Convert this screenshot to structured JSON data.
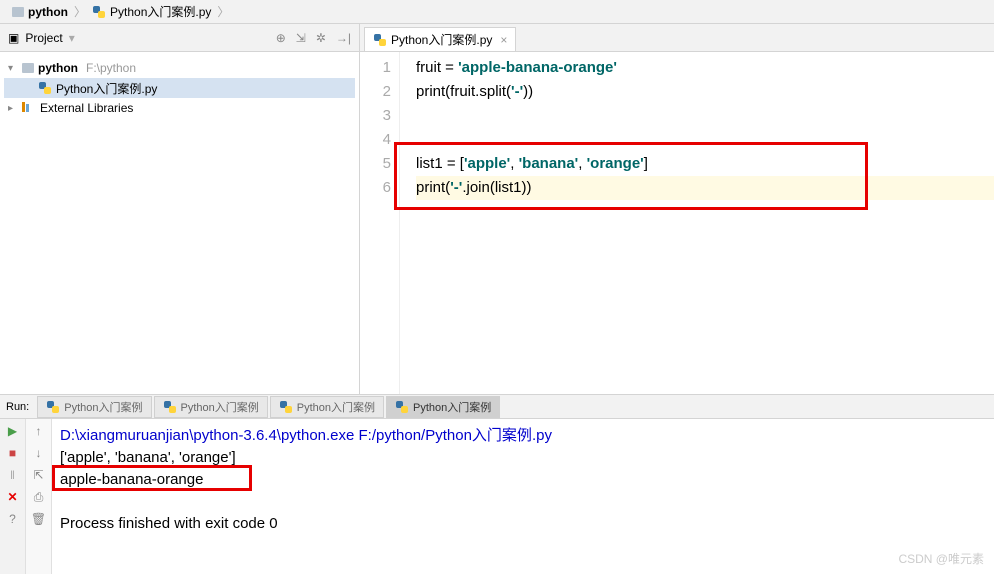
{
  "breadcrumb": {
    "root": "python",
    "file": "Python入门案例.py"
  },
  "project": {
    "header": "Project",
    "root": "python",
    "root_path": "F:\\python",
    "file": "Python入门案例.py",
    "external": "External Libraries"
  },
  "tab": {
    "name": "Python入门案例.py"
  },
  "code": {
    "l1": "fruit = 'apple-banana-orange'",
    "l2_a": "print(fruit.split(",
    "l2_b": "'-'",
    "l2_c": "))",
    "l3": "",
    "l4": "",
    "l5_a": "list1 = [",
    "l5_b": "'apple'",
    "l5_c": ", ",
    "l5_d": "'banana'",
    "l5_e": ", ",
    "l5_f": "'orange'",
    "l5_g": "]",
    "l6_a": "print(",
    "l6_b": "'-'",
    "l6_c": ".join(list1))"
  },
  "gutter": [
    "1",
    "2",
    "3",
    "4",
    "5",
    "6"
  ],
  "run": {
    "label": "Run:",
    "tabs": [
      "Python入门案例",
      "Python入门案例",
      "Python入门案例",
      "Python入门案例"
    ],
    "line1_a": "D:\\xiangmuruanjian\\python-3.6.4\\python.exe F:/python/Python",
    "line1_b": "入门案例",
    "line1_c": ".py",
    "line2": "['apple', 'banana', 'orange']",
    "line3": "apple-banana-orange",
    "line5": "Process finished with exit code 0"
  },
  "watermark": "CSDN @唯元素"
}
